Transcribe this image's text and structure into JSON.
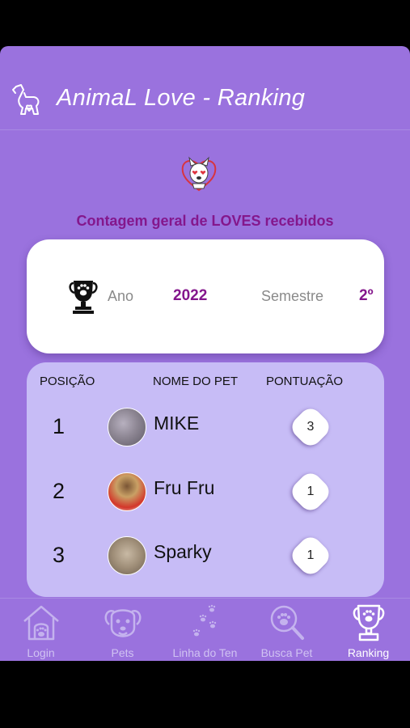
{
  "app": {
    "title": "AnimaL Love - Ranking"
  },
  "subtitle": "Contagem geral de LOVES recebidos",
  "period": {
    "year_label": "Ano",
    "year_value": "2022",
    "semester_label": "Semestre",
    "semester_value": "2º"
  },
  "ranking": {
    "headers": {
      "position": "POSIÇÃO",
      "pet_name": "NOME DO PET",
      "score": "PONTUAÇÃO"
    },
    "rows": [
      {
        "position": "1",
        "name": "MIKE",
        "score": "3"
      },
      {
        "position": "2",
        "name": "Fru Fru",
        "score": "1"
      },
      {
        "position": "3",
        "name": "Sparky",
        "score": "1"
      }
    ]
  },
  "tabs": [
    {
      "label": "Login",
      "icon": "doghouse-icon"
    },
    {
      "label": "Pets",
      "icon": "dog-face-icon"
    },
    {
      "label": "Linha do Ten",
      "icon": "paw-trail-icon"
    },
    {
      "label": "Busca Pet",
      "icon": "search-pet-icon"
    },
    {
      "label": "Ranking",
      "icon": "trophy-icon",
      "active": true
    }
  ],
  "colors": {
    "background": "#9a72de",
    "accent": "#84178c",
    "card": "#ffffff",
    "ranking_card": "#c7bcf6"
  }
}
